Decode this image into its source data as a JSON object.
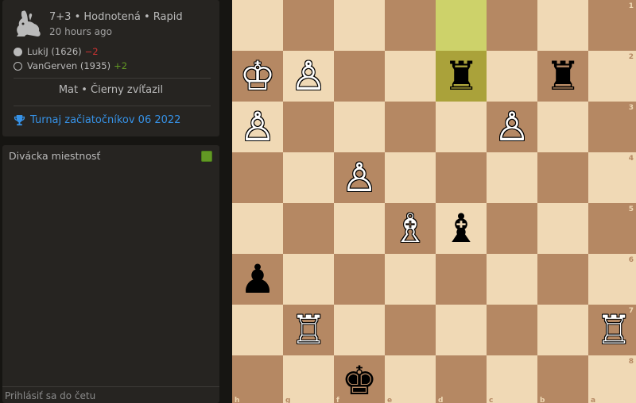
{
  "game": {
    "setup": "7+3 • Hodnotená • Rapid",
    "date": "20 hours ago",
    "players": [
      {
        "name": "LukiJ (1626)",
        "diff": "−2",
        "color": "white"
      },
      {
        "name": "VanGerven (1935)",
        "diff": "+2",
        "color": "black"
      }
    ],
    "status": "Mat • Čierny zvíťazil",
    "tournament": "Turnaj začiatočníkov 06 2022",
    "variant_icon": "rabbit-icon"
  },
  "chat": {
    "title": "Divácka miestnosť",
    "placeholder": "Prihlásiť sa do četu"
  },
  "board": {
    "orientation": "black",
    "files_label": [
      "h",
      "g",
      "f",
      "e",
      "d",
      "c",
      "b",
      "a"
    ],
    "ranks_label": [
      "1",
      "2",
      "3",
      "4",
      "5",
      "6",
      "7",
      "8"
    ],
    "highlight": [
      "d1",
      "d2"
    ],
    "pieces": [
      {
        "square": "h2",
        "color": "w",
        "type": "king"
      },
      {
        "square": "g2",
        "color": "w",
        "type": "pawn"
      },
      {
        "square": "d2",
        "color": "b",
        "type": "rook"
      },
      {
        "square": "b2",
        "color": "b",
        "type": "rook"
      },
      {
        "square": "h3",
        "color": "w",
        "type": "pawn"
      },
      {
        "square": "c3",
        "color": "w",
        "type": "pawn"
      },
      {
        "square": "f4",
        "color": "w",
        "type": "pawn"
      },
      {
        "square": "e5",
        "color": "w",
        "type": "bishop"
      },
      {
        "square": "d5",
        "color": "b",
        "type": "bishop"
      },
      {
        "square": "h6",
        "color": "b",
        "type": "pawn"
      },
      {
        "square": "g7",
        "color": "w",
        "type": "rook"
      },
      {
        "square": "a7",
        "color": "w",
        "type": "rook"
      },
      {
        "square": "f8",
        "color": "b",
        "type": "king"
      }
    ]
  },
  "colors": {
    "light_square": "#f0d9b5",
    "dark_square": "#b58863",
    "highlight": "#cdd26a",
    "link": "#3692e7",
    "loss": "#cc3333",
    "gain": "#629924"
  }
}
